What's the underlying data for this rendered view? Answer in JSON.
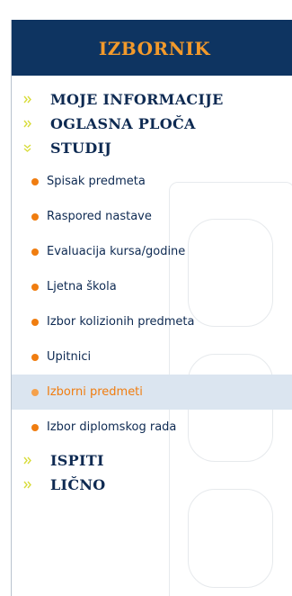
{
  "menu": {
    "title": "IZBORNIK",
    "top_items": [
      {
        "label": "MOJE INFORMACIJE"
      },
      {
        "label": "OGLASNA PLOČA"
      },
      {
        "label": "STUDIJ"
      },
      {
        "label": "ISPITI"
      },
      {
        "label": "LIČNO"
      }
    ],
    "studij_sub_items": [
      {
        "label": "Spisak predmeta"
      },
      {
        "label": "Raspored nastave"
      },
      {
        "label": "Evaluacija kursa/godine"
      },
      {
        "label": "Ljetna škola"
      },
      {
        "label": "Izbor kolizionih predmeta"
      },
      {
        "label": "Upitnici"
      },
      {
        "label": "Izborni predmeti"
      },
      {
        "label": "Izbor diplomskog rada"
      }
    ],
    "active_sub_item": "Izborni predmeti"
  },
  "colors": {
    "header_bg": "#0e3461",
    "title": "#f39a2b",
    "arrow": "#d8dc3a",
    "bullet": "#f07d10",
    "active_bg": "#dbe5f0",
    "text": "#0e2a52"
  },
  "icons": {
    "collapsed_arrow": "double-chevron-right-icon",
    "expanded_arrow": "double-chevron-down-icon",
    "bullet": "orange-dot-icon"
  }
}
